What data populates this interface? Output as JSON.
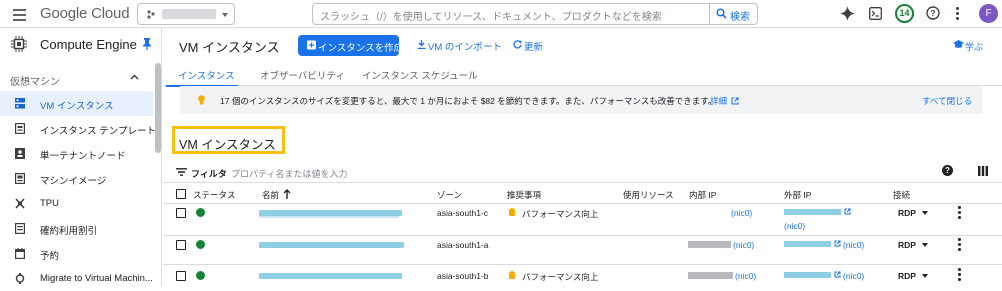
{
  "topbar": {
    "logo_google": "Google",
    "logo_cloud": "Cloud",
    "search_placeholder": "スラッシュ（/）を使用してリソース、ドキュメント、プロダクトなどを検索",
    "search_button": "検索",
    "notifications_count": "14",
    "avatar_initial": "F"
  },
  "sidenav": {
    "product_title": "Compute Engine",
    "section_label": "仮想マシン",
    "items": [
      {
        "label": "VM インスタンス",
        "icon": "vm-icon",
        "active": true
      },
      {
        "label": "インスタンス テンプレート",
        "icon": "template-icon"
      },
      {
        "label": "単一テナントノード",
        "icon": "sole-tenant-icon"
      },
      {
        "label": "マシンイメージ",
        "icon": "machine-image-icon"
      },
      {
        "label": "TPU",
        "icon": "tpu-icon"
      },
      {
        "label": "確約利用割引",
        "icon": "discount-icon"
      },
      {
        "label": "予約",
        "icon": "reservation-icon"
      },
      {
        "label": "Migrate to Virtual Machin...",
        "icon": "migrate-icon"
      }
    ]
  },
  "header": {
    "title": "VM インスタンス",
    "create_button": "インスタンスを作成",
    "import_button": "VM のインポート",
    "refresh_button": "更新",
    "learn_link": "学ぶ"
  },
  "tabs": [
    "インスタンス",
    "オブザーバビリティ",
    "インスタンス スケジュール"
  ],
  "banner": {
    "text": "17 個のインスタンスのサイズを変更すると、最大で 1 か月におよそ $82 を節約できます。また、パフォーマンスも改善できます。",
    "details_link": "詳細",
    "close_all": "すべて閉じる"
  },
  "section_title": "VM インスタンス",
  "filter": {
    "label": "フィルタ",
    "placeholder": "プロパティ名または値を入力"
  },
  "table": {
    "columns": [
      "ステータス",
      "名前",
      "ゾーン",
      "推奨事項",
      "使用リソース",
      "内部 IP",
      "外部 IP",
      "接続"
    ],
    "rows": [
      {
        "zone": "asia-south1-c",
        "recommendation": "パフォーマンス向上",
        "internal_nic": "(nic0)",
        "external_nic": "(nic0)",
        "connect": "RDP"
      },
      {
        "zone": "asia-south1-a",
        "recommendation": "",
        "internal_nic": "(nic0)",
        "external_nic": "(nic0)",
        "connect": "RDP"
      },
      {
        "zone": "asia-south1-b",
        "recommendation": "パフォーマンス向上",
        "internal_nic": "(nic0)",
        "external_nic": "(nic0)",
        "connect": "RDP"
      }
    ]
  },
  "colors": {
    "accent": "#1a73e8",
    "status_ok": "#188038",
    "highlight": "#f4c20d"
  }
}
